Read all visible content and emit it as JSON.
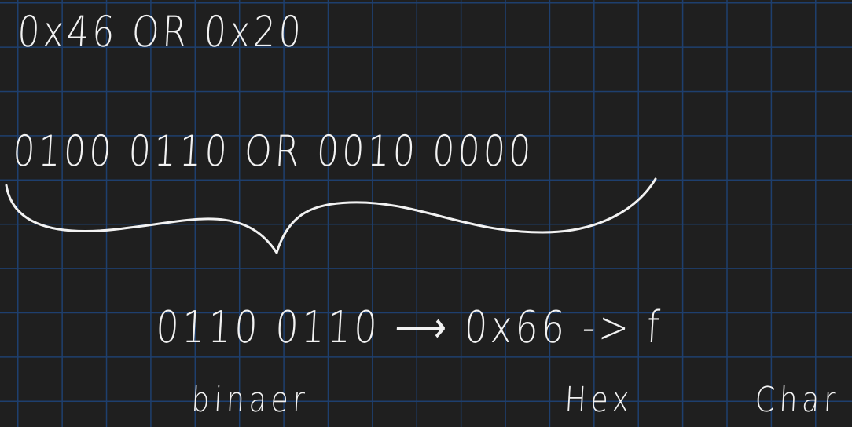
{
  "note": {
    "expression": "0x46 OR 0x20",
    "binary_expression": "0100 0110 OR 0010 0000",
    "result": "0110 0110 ⟶ 0x66 -> f",
    "labels": {
      "binary": "binaer",
      "hex": "Hex",
      "char": "Char"
    }
  },
  "colors": {
    "background": "#1f1f1f",
    "grid": "#1e3f6e",
    "ink": "#f2f2f2"
  }
}
